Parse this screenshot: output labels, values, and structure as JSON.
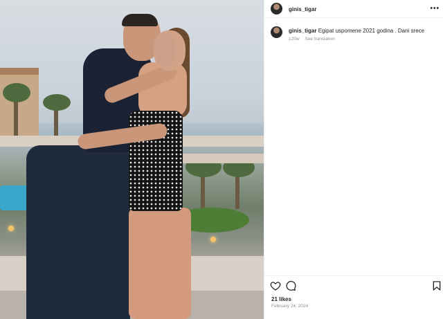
{
  "post": {
    "username": "ginis_tigar",
    "more_icon": "more-horizontal-icon"
  },
  "caption": {
    "username": "ginis_tigar",
    "text": "Egipat uspomene 2021 godina . Dani srece",
    "age": "120w",
    "translate_label": "See translation"
  },
  "actions": {
    "icons": [
      "heart-icon",
      "comment-icon",
      "bookmark-icon"
    ]
  },
  "likes": "21 likes",
  "date": "February 24, 2024"
}
